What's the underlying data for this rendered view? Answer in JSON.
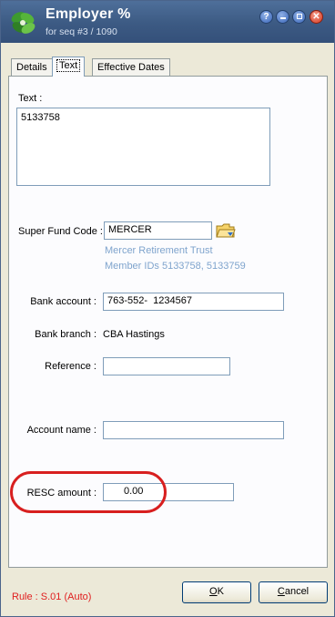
{
  "window": {
    "title": "Employer %",
    "subtitle": "for seq #3 / 1090",
    "buttons": {
      "help": "?",
      "close": "✕"
    }
  },
  "tabs": [
    {
      "label": "Details",
      "active": false
    },
    {
      "label": "Text",
      "active": true
    },
    {
      "label": "Effective Dates",
      "active": false
    }
  ],
  "form": {
    "text_label": "Text :",
    "text_value": "5133758",
    "super_fund_code_label": "Super Fund Code :",
    "super_fund_code_value": "MERCER",
    "fund_name": "Mercer Retirement Trust",
    "member_ids": "Member IDs 5133758, 5133759",
    "bank_account_label": "Bank account :",
    "bank_account_value": "763-552-  1234567",
    "bank_branch_label": "Bank branch :",
    "bank_branch_value": "CBA Hastings",
    "reference_label": "Reference :",
    "reference_value": "",
    "account_name_label": "Account name :",
    "account_name_value": "",
    "resc_amount_label": "RESC amount :",
    "resc_amount_value": "0.00"
  },
  "footer": {
    "rule_text": "Rule : S.01 (Auto)",
    "ok_label": "K",
    "ok_mnemonic": "O",
    "cancel_label": "ancel",
    "cancel_mnemonic": "C"
  },
  "colors": {
    "titlebar": "#3c5a83",
    "info_text": "#7fa4cd",
    "highlight": "#d81f1f",
    "rule_text": "#e02020"
  },
  "icons": {
    "app": "green-leaf-people-icon",
    "lookup": "folder-lookup-icon"
  }
}
